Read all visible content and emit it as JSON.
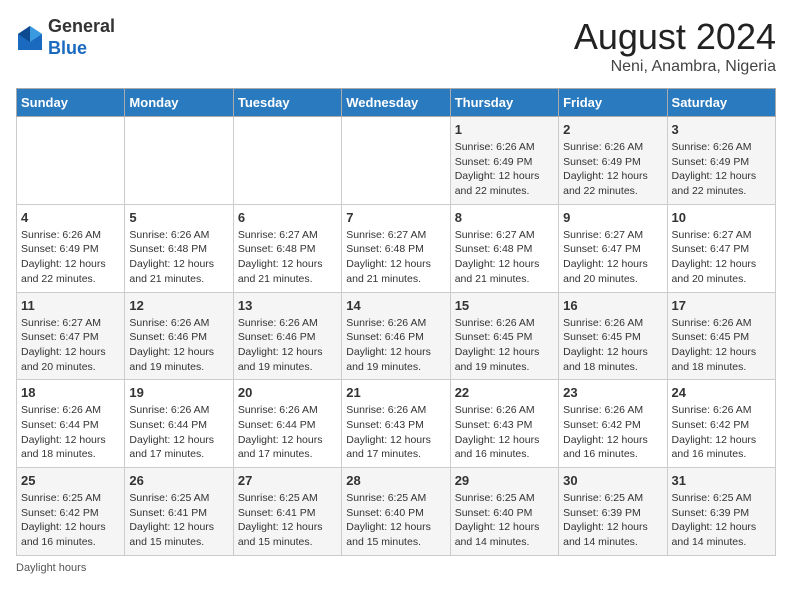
{
  "header": {
    "logo_line1": "General",
    "logo_line2": "Blue",
    "main_title": "August 2024",
    "subtitle": "Neni, Anambra, Nigeria"
  },
  "weekdays": [
    "Sunday",
    "Monday",
    "Tuesday",
    "Wednesday",
    "Thursday",
    "Friday",
    "Saturday"
  ],
  "weeks": [
    [
      null,
      null,
      null,
      null,
      {
        "day": "1",
        "sunrise": "6:26 AM",
        "sunset": "6:49 PM",
        "daylight": "12 hours and 22 minutes."
      },
      {
        "day": "2",
        "sunrise": "6:26 AM",
        "sunset": "6:49 PM",
        "daylight": "12 hours and 22 minutes."
      },
      {
        "day": "3",
        "sunrise": "6:26 AM",
        "sunset": "6:49 PM",
        "daylight": "12 hours and 22 minutes."
      }
    ],
    [
      {
        "day": "4",
        "sunrise": "6:26 AM",
        "sunset": "6:49 PM",
        "daylight": "12 hours and 22 minutes."
      },
      {
        "day": "5",
        "sunrise": "6:26 AM",
        "sunset": "6:48 PM",
        "daylight": "12 hours and 21 minutes."
      },
      {
        "day": "6",
        "sunrise": "6:27 AM",
        "sunset": "6:48 PM",
        "daylight": "12 hours and 21 minutes."
      },
      {
        "day": "7",
        "sunrise": "6:27 AM",
        "sunset": "6:48 PM",
        "daylight": "12 hours and 21 minutes."
      },
      {
        "day": "8",
        "sunrise": "6:27 AM",
        "sunset": "6:48 PM",
        "daylight": "12 hours and 21 minutes."
      },
      {
        "day": "9",
        "sunrise": "6:27 AM",
        "sunset": "6:47 PM",
        "daylight": "12 hours and 20 minutes."
      },
      {
        "day": "10",
        "sunrise": "6:27 AM",
        "sunset": "6:47 PM",
        "daylight": "12 hours and 20 minutes."
      }
    ],
    [
      {
        "day": "11",
        "sunrise": "6:27 AM",
        "sunset": "6:47 PM",
        "daylight": "12 hours and 20 minutes."
      },
      {
        "day": "12",
        "sunrise": "6:26 AM",
        "sunset": "6:46 PM",
        "daylight": "12 hours and 19 minutes."
      },
      {
        "day": "13",
        "sunrise": "6:26 AM",
        "sunset": "6:46 PM",
        "daylight": "12 hours and 19 minutes."
      },
      {
        "day": "14",
        "sunrise": "6:26 AM",
        "sunset": "6:46 PM",
        "daylight": "12 hours and 19 minutes."
      },
      {
        "day": "15",
        "sunrise": "6:26 AM",
        "sunset": "6:45 PM",
        "daylight": "12 hours and 19 minutes."
      },
      {
        "day": "16",
        "sunrise": "6:26 AM",
        "sunset": "6:45 PM",
        "daylight": "12 hours and 18 minutes."
      },
      {
        "day": "17",
        "sunrise": "6:26 AM",
        "sunset": "6:45 PM",
        "daylight": "12 hours and 18 minutes."
      }
    ],
    [
      {
        "day": "18",
        "sunrise": "6:26 AM",
        "sunset": "6:44 PM",
        "daylight": "12 hours and 18 minutes."
      },
      {
        "day": "19",
        "sunrise": "6:26 AM",
        "sunset": "6:44 PM",
        "daylight": "12 hours and 17 minutes."
      },
      {
        "day": "20",
        "sunrise": "6:26 AM",
        "sunset": "6:44 PM",
        "daylight": "12 hours and 17 minutes."
      },
      {
        "day": "21",
        "sunrise": "6:26 AM",
        "sunset": "6:43 PM",
        "daylight": "12 hours and 17 minutes."
      },
      {
        "day": "22",
        "sunrise": "6:26 AM",
        "sunset": "6:43 PM",
        "daylight": "12 hours and 16 minutes."
      },
      {
        "day": "23",
        "sunrise": "6:26 AM",
        "sunset": "6:42 PM",
        "daylight": "12 hours and 16 minutes."
      },
      {
        "day": "24",
        "sunrise": "6:26 AM",
        "sunset": "6:42 PM",
        "daylight": "12 hours and 16 minutes."
      }
    ],
    [
      {
        "day": "25",
        "sunrise": "6:25 AM",
        "sunset": "6:42 PM",
        "daylight": "12 hours and 16 minutes."
      },
      {
        "day": "26",
        "sunrise": "6:25 AM",
        "sunset": "6:41 PM",
        "daylight": "12 hours and 15 minutes."
      },
      {
        "day": "27",
        "sunrise": "6:25 AM",
        "sunset": "6:41 PM",
        "daylight": "12 hours and 15 minutes."
      },
      {
        "day": "28",
        "sunrise": "6:25 AM",
        "sunset": "6:40 PM",
        "daylight": "12 hours and 15 minutes."
      },
      {
        "day": "29",
        "sunrise": "6:25 AM",
        "sunset": "6:40 PM",
        "daylight": "12 hours and 14 minutes."
      },
      {
        "day": "30",
        "sunrise": "6:25 AM",
        "sunset": "6:39 PM",
        "daylight": "12 hours and 14 minutes."
      },
      {
        "day": "31",
        "sunrise": "6:25 AM",
        "sunset": "6:39 PM",
        "daylight": "12 hours and 14 minutes."
      }
    ]
  ],
  "footer": {
    "daylight_label": "Daylight hours"
  }
}
